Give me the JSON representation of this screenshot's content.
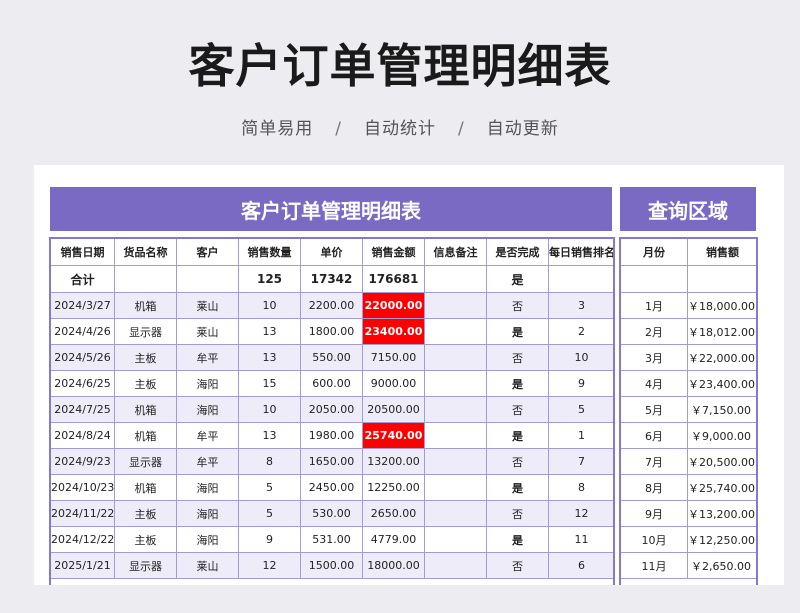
{
  "page": {
    "title": "客户订单管理明细表",
    "subtitle": [
      "简单易用",
      "自动统计",
      "自动更新"
    ],
    "separator": "/"
  },
  "main_panel": {
    "title": "客户订单管理明细表",
    "headers": [
      "销售日期",
      "货品名称",
      "客户",
      "销售数量",
      "单价",
      "销售金额",
      "信息备注",
      "是否完成",
      "每日销售排名"
    ],
    "total": {
      "label": "合计",
      "qty": "125",
      "price": "17342",
      "amount": "176681",
      "done": "是"
    },
    "rows": [
      {
        "date": "2024/3/27",
        "item": "机箱",
        "customer": "莱山",
        "qty": "10",
        "price": "2200.00",
        "amount": "22000.00",
        "note": "",
        "done": "否",
        "rank": "3",
        "highlight": true
      },
      {
        "date": "2024/4/26",
        "item": "显示器",
        "customer": "莱山",
        "qty": "13",
        "price": "1800.00",
        "amount": "23400.00",
        "note": "",
        "done": "是",
        "rank": "2",
        "highlight": true
      },
      {
        "date": "2024/5/26",
        "item": "主板",
        "customer": "牟平",
        "qty": "13",
        "price": "550.00",
        "amount": "7150.00",
        "note": "",
        "done": "否",
        "rank": "10",
        "highlight": false
      },
      {
        "date": "2024/6/25",
        "item": "主板",
        "customer": "海阳",
        "qty": "15",
        "price": "600.00",
        "amount": "9000.00",
        "note": "",
        "done": "是",
        "rank": "9",
        "highlight": false
      },
      {
        "date": "2024/7/25",
        "item": "机箱",
        "customer": "海阳",
        "qty": "10",
        "price": "2050.00",
        "amount": "20500.00",
        "note": "",
        "done": "否",
        "rank": "5",
        "highlight": false
      },
      {
        "date": "2024/8/24",
        "item": "机箱",
        "customer": "牟平",
        "qty": "13",
        "price": "1980.00",
        "amount": "25740.00",
        "note": "",
        "done": "是",
        "rank": "1",
        "highlight": true
      },
      {
        "date": "2024/9/23",
        "item": "显示器",
        "customer": "牟平",
        "qty": "8",
        "price": "1650.00",
        "amount": "13200.00",
        "note": "",
        "done": "否",
        "rank": "7",
        "highlight": false
      },
      {
        "date": "2024/10/23",
        "item": "机箱",
        "customer": "海阳",
        "qty": "5",
        "price": "2450.00",
        "amount": "12250.00",
        "note": "",
        "done": "是",
        "rank": "8",
        "highlight": false
      },
      {
        "date": "2024/11/22",
        "item": "主板",
        "customer": "海阳",
        "qty": "5",
        "price": "530.00",
        "amount": "2650.00",
        "note": "",
        "done": "否",
        "rank": "12",
        "highlight": false
      },
      {
        "date": "2024/12/22",
        "item": "主板",
        "customer": "海阳",
        "qty": "9",
        "price": "531.00",
        "amount": "4779.00",
        "note": "",
        "done": "是",
        "rank": "11",
        "highlight": false
      },
      {
        "date": "2025/1/21",
        "item": "显示器",
        "customer": "莱山",
        "qty": "12",
        "price": "1500.00",
        "amount": "18000.00",
        "note": "",
        "done": "否",
        "rank": "6",
        "highlight": false
      }
    ]
  },
  "query_panel": {
    "title": "查询区域",
    "headers": [
      "月份",
      "销售额"
    ],
    "rows": [
      {
        "month": "1月",
        "sales": "￥18,000.00"
      },
      {
        "month": "2月",
        "sales": "￥18,012.00"
      },
      {
        "month": "3月",
        "sales": "￥22,000.00"
      },
      {
        "month": "4月",
        "sales": "￥23,400.00"
      },
      {
        "month": "5月",
        "sales": "￥7,150.00"
      },
      {
        "month": "6月",
        "sales": "￥9,000.00"
      },
      {
        "month": "7月",
        "sales": "￥20,500.00"
      },
      {
        "month": "8月",
        "sales": "￥25,740.00"
      },
      {
        "month": "9月",
        "sales": "￥13,200.00"
      },
      {
        "month": "10月",
        "sales": "￥12,250.00"
      },
      {
        "month": "11月",
        "sales": "￥2,650.00"
      }
    ]
  },
  "colors": {
    "accent": "#7b6ac3",
    "highlight": "#ff0000",
    "alt_row": "#eeecf8"
  }
}
